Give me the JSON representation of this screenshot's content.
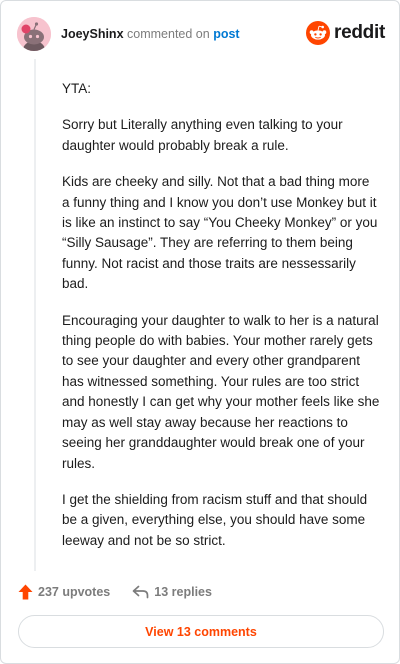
{
  "header": {
    "username": "JoeyShinx",
    "action": "commented on",
    "target": "post",
    "brand": "reddit"
  },
  "comment": {
    "paragraphs": [
      "YTA:",
      "Sorry but Literally anything even talking to your daughter would probably break a rule.",
      "Kids are cheeky and silly. Not that a bad thing more a funny thing and I know you don’t use Monkey but it is like an instinct to say “You Cheeky Monkey” or you “Silly Sausage”. They are referring to them being funny. Not racist and those traits are nessessarily bad.",
      "Encouraging your daughter to walk to her is a natural thing people do with babies. Your mother rarely gets to see your daughter and every other grandparent has witnessed something. Your rules are too strict and honestly I can get why your mother feels like she may as well stay away because her reactions to seeing her granddaughter would break one of your rules.",
      "I get the shielding from racism stuff and that should be a given, everything else, you should have some leeway and not be so strict."
    ]
  },
  "footer": {
    "upvotes": "237 upvotes",
    "replies": "13 replies",
    "view_comments": "View 13 comments"
  },
  "colors": {
    "accent": "#ff4500",
    "link": "#0079d3",
    "muted": "#7c7c7c"
  }
}
